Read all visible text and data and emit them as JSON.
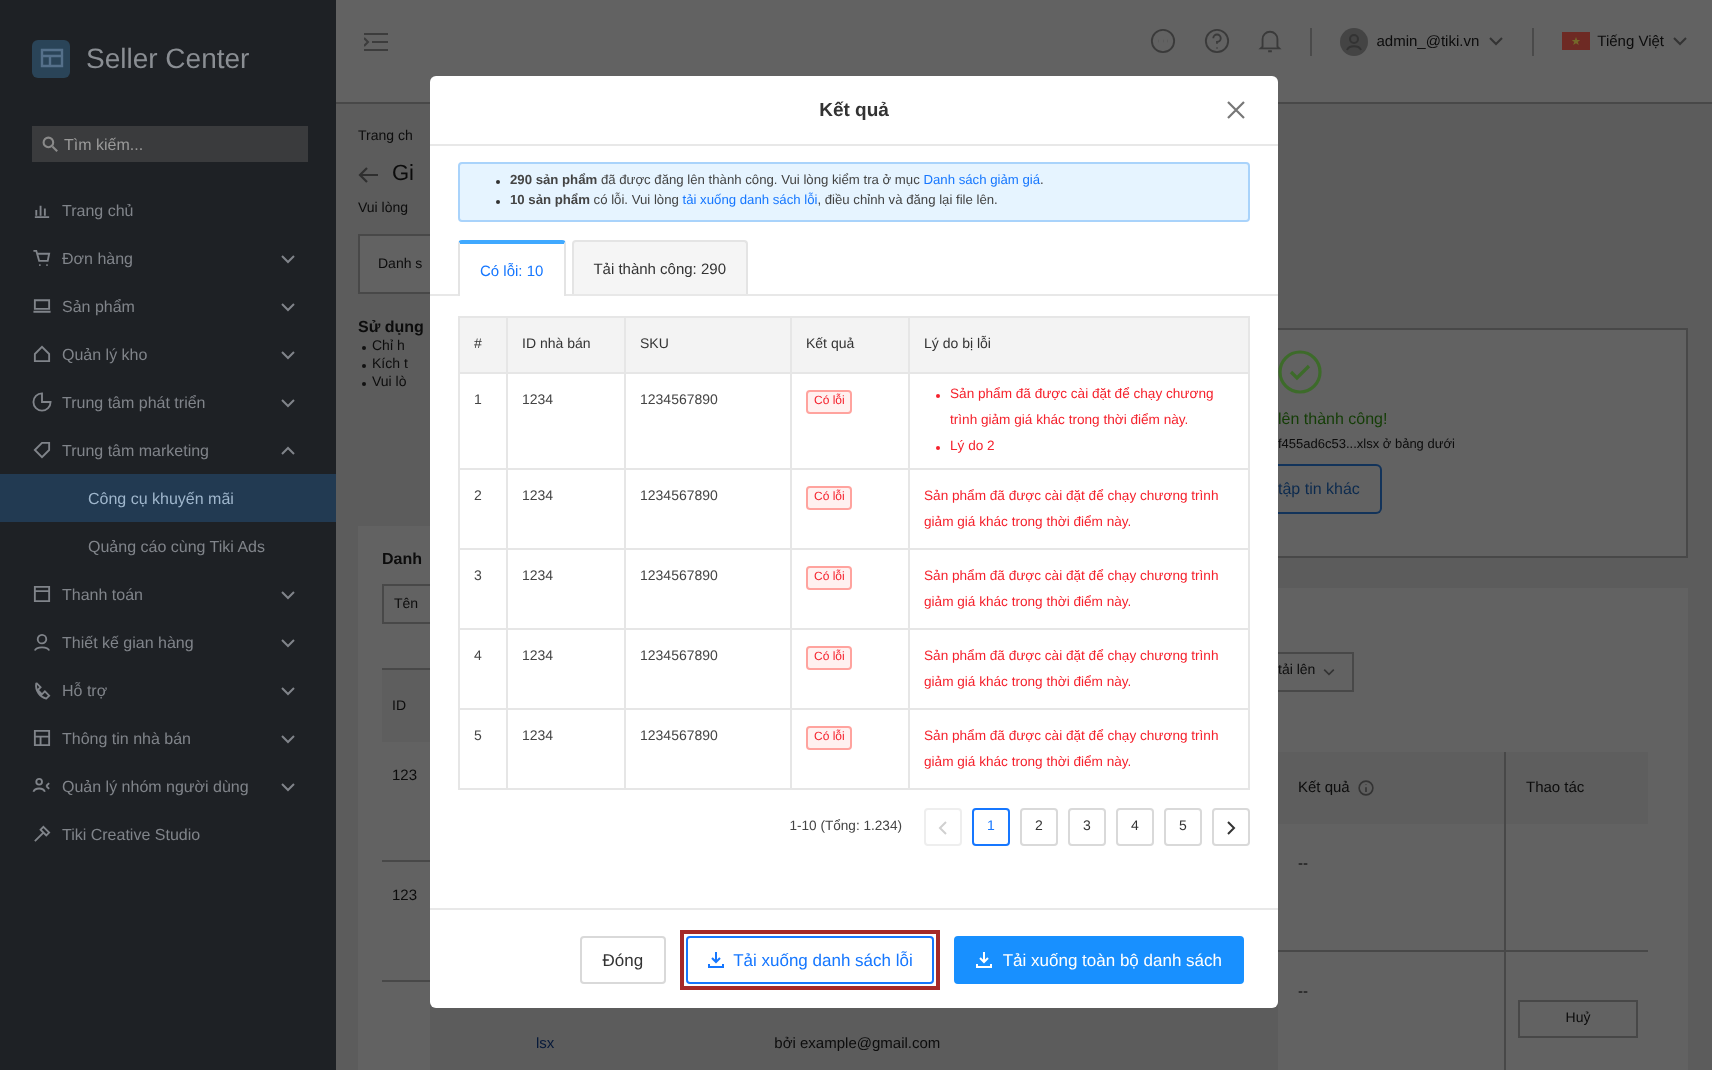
{
  "sidebar": {
    "brand": "Seller Center",
    "search_placeholder": "Tìm kiếm...",
    "items": [
      {
        "label": "Trang chủ",
        "expandable": false,
        "selected": false
      },
      {
        "label": "Đơn hàng",
        "expandable": true,
        "expanded": false,
        "selected": false
      },
      {
        "label": "Sản phẩm",
        "expandable": true,
        "expanded": false,
        "selected": false
      },
      {
        "label": "Quản lý kho",
        "expandable": true,
        "expanded": false,
        "selected": false
      },
      {
        "label": "Trung tâm phát triển",
        "expandable": true,
        "expanded": false,
        "selected": false
      },
      {
        "label": "Trung tâm marketing",
        "expandable": true,
        "expanded": true,
        "selected": false,
        "children": [
          {
            "label": "Công cụ khuyến mãi",
            "selected": true
          },
          {
            "label": "Quảng cáo cùng Tiki Ads",
            "selected": false
          }
        ]
      },
      {
        "label": "Thanh toán",
        "expandable": true,
        "expanded": false,
        "selected": false
      },
      {
        "label": "Thiết kế gian hàng",
        "expandable": true,
        "expanded": false,
        "selected": false
      },
      {
        "label": "Hỗ trợ",
        "expandable": true,
        "expanded": false,
        "selected": false
      },
      {
        "label": "Thông tin nhà bán",
        "expandable": true,
        "expanded": false,
        "selected": false
      },
      {
        "label": "Quản lý nhóm người dùng",
        "expandable": true,
        "expanded": false,
        "selected": false
      },
      {
        "label": "Tiki Creative Studio",
        "expandable": false,
        "selected": false
      }
    ]
  },
  "header": {
    "user": "admin_@tiki.vn",
    "language": "Tiếng Việt"
  },
  "page": {
    "breadcrumb": "Trang ch",
    "title": "Gi",
    "subtitle": "Vui lòng",
    "tab": "Danh s",
    "section_title": "Sử dụng",
    "bullets": [
      "Chỉ h",
      "Kích t",
      "Vui lò"
    ],
    "list_title": "Danh",
    "filter": "Tên",
    "table_header": "ID",
    "table_cells": [
      "123",
      "123"
    ],
    "upload_status": "lên thành công!",
    "file_note": "f455ad6c53...xlsx ở bảng dưới",
    "upload_button": "tập tin khác",
    "filter_select": "tải lên",
    "columns": [
      "Kết quả",
      "Thao tác"
    ],
    "rows": [
      {
        "result": "--"
      },
      {
        "result": "--",
        "action": "Huỷ"
      }
    ],
    "file_link": "lsx",
    "uploaded_by": "bởi example@gmail.com"
  },
  "modal": {
    "title": "Kết quả",
    "alert": [
      {
        "text": "**290 sản phẩm** đã được đăng lên thành công. Vui lòng kiểm tra ở mục ",
        "link": "Danh sách giảm giá",
        "after": "."
      },
      {
        "text": "**10 sản phẩm** có lỗi. Vui lòng ",
        "link": "tải xuống danh sách lỗi",
        "after": ", điều chỉnh và đăng lại file lên."
      }
    ],
    "tabs": [
      {
        "label": "Có lỗi: 10",
        "selected": true
      },
      {
        "label": "Tải thành công: 290",
        "selected": false
      }
    ],
    "columns": [
      "#",
      "ID nhà bán",
      "SKU",
      "Kết quả",
      "Lý do bị lỗi"
    ],
    "rows": [
      {
        "index": "1",
        "seller_id": "1234",
        "sku": "1234567890",
        "result": "Có lỗi",
        "reasons": [
          "Sản phẩm đã được cài đặt để chạy chương trình giảm giá khác trong thời điểm này.",
          "Lý do 2"
        ]
      },
      {
        "index": "2",
        "seller_id": "1234",
        "sku": "1234567890",
        "result": "Có lỗi",
        "reasons": [
          "Sản phẩm đã được cài đặt để chạy chương trình giảm giá khác trong thời điểm này."
        ]
      },
      {
        "index": "3",
        "seller_id": "1234",
        "sku": "1234567890",
        "result": "Có lỗi",
        "reasons": [
          "Sản phẩm đã được cài đặt để chạy chương trình giảm giá khác trong thời điểm này."
        ]
      },
      {
        "index": "4",
        "seller_id": "1234",
        "sku": "1234567890",
        "result": "Có lỗi",
        "reasons": [
          "Sản phẩm đã được cài đặt để chạy chương trình giảm giá khác trong thời điểm này."
        ]
      },
      {
        "index": "5",
        "seller_id": "1234",
        "sku": "1234567890",
        "result": "Có lỗi",
        "reasons": [
          "Sản phẩm đã được cài đặt để chạy chương trình giảm giá khác trong thời điểm này."
        ]
      }
    ],
    "pagination": {
      "summary": "1-10 (Tổng: 1.234)",
      "prev_disabled": true,
      "next_disabled": false,
      "pages": [
        {
          "label": "1",
          "selected": true
        },
        {
          "label": "2",
          "selected": false
        },
        {
          "label": "3",
          "selected": false
        },
        {
          "label": "4",
          "selected": false
        },
        {
          "label": "5",
          "selected": false
        }
      ]
    },
    "buttons": [
      {
        "label": "Đóng",
        "kind": "default",
        "highlighted": false
      },
      {
        "label": "Tải xuống danh sách lỗi",
        "kind": "outline",
        "highlighted": true
      },
      {
        "label": "Tải xuống toàn bộ danh sách",
        "kind": "primary",
        "highlighted": false
      }
    ]
  }
}
